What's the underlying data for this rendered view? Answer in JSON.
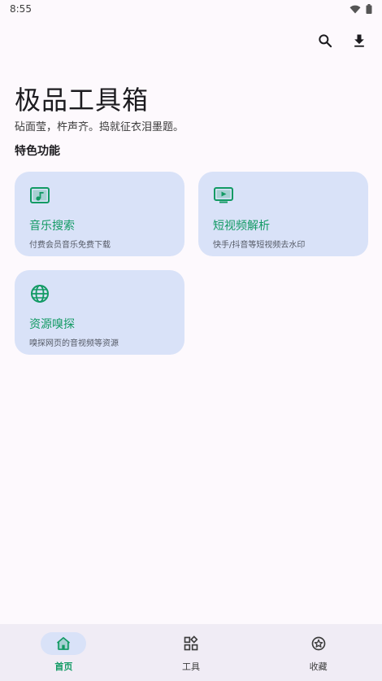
{
  "status_bar": {
    "time": "8:55"
  },
  "icons": {
    "search": "search-icon",
    "download": "download-icon",
    "wifi": "wifi-icon",
    "battery": "battery-icon"
  },
  "colors": {
    "accent": "#129a64",
    "card_bg": "#d9e2f8",
    "nav_bg": "#f0ecf5",
    "page_bg": "#fdf9fd"
  },
  "header": {
    "title": "极品工具箱",
    "subtitle": "砧面莹，杵声齐。捣就征衣泪墨题。"
  },
  "section": {
    "title": "特色功能"
  },
  "cards": [
    {
      "title": "音乐搜索",
      "desc": "付费会员音乐免费下载",
      "icon": "music-icon"
    },
    {
      "title": "短视频解析",
      "desc": "快手/抖音等短视频去水印",
      "icon": "video-icon"
    },
    {
      "title": "资源嗅探",
      "desc": "嗅探网页的音视频等资源",
      "icon": "globe-icon"
    }
  ],
  "bottom_nav": [
    {
      "label": "首页",
      "icon": "home-icon",
      "active": true
    },
    {
      "label": "工具",
      "icon": "apps-icon",
      "active": false
    },
    {
      "label": "收藏",
      "icon": "star-icon",
      "active": false
    }
  ]
}
